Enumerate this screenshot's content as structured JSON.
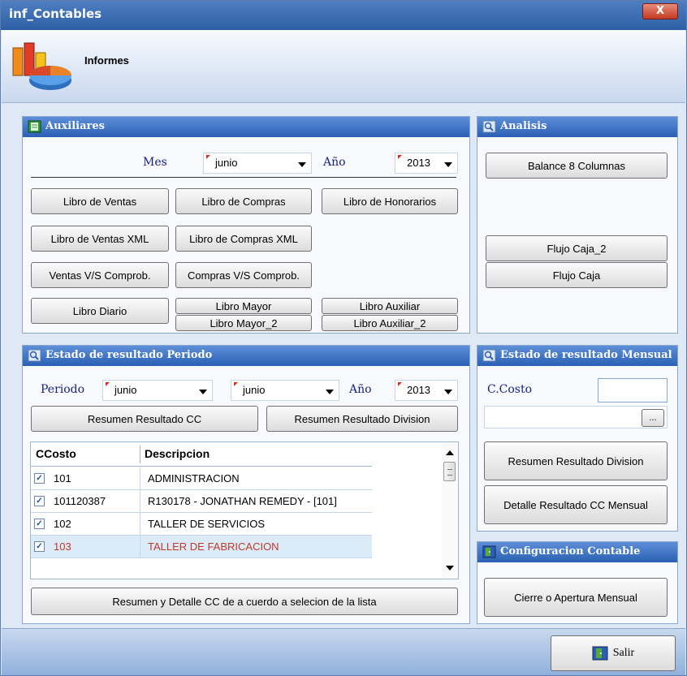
{
  "window": {
    "title": "inf_Contables",
    "close_label": "X"
  },
  "header": {
    "title": "Informes"
  },
  "auxiliares": {
    "title": "Auxiliares",
    "mes_label": "Mes",
    "mes_value": "junio",
    "anio_label": "Año",
    "anio_value": "2013",
    "buttons": {
      "libro_ventas": "Libro de Ventas",
      "libro_compras": "Libro de Compras",
      "libro_honorarios": "Libro de Honorarios",
      "libro_ventas_xml": "Libro de Ventas XML",
      "libro_compras_xml": "Libro de Compras XML",
      "ventas_vs": "Ventas V/S Comprob.",
      "compras_vs": "Compras V/S Comprob.",
      "libro_diario": "Libro Diario",
      "libro_mayor": "Libro Mayor",
      "libro_mayor_2": "Libro Mayor_2",
      "libro_auxiliar": "Libro Auxiliar",
      "libro_auxiliar_2": "Libro Auxiliar_2"
    }
  },
  "analisis": {
    "title": "Analisis",
    "balance": "Balance 8 Columnas",
    "flujo_caja_2": "Flujo Caja_2",
    "flujo_caja": "Flujo Caja"
  },
  "periodo": {
    "title": "Estado de resultado Periodo",
    "periodo_label": "Periodo",
    "desde": "junio",
    "hasta": "junio",
    "anio_label": "Año",
    "anio_value": "2013",
    "resumen_cc": "Resumen Resultado CC",
    "resumen_div": "Resumen Resultado Division",
    "grid": {
      "headers": [
        "CCosto",
        "Descripcion"
      ],
      "rows": [
        {
          "check": "✓",
          "code": "101",
          "desc": "ADMINISTRACION"
        },
        {
          "check": "✓",
          "code": "101120387",
          "desc": "R130178 - JONATHAN REMEDY - [101]"
        },
        {
          "check": "✓",
          "code": "102",
          "desc": "TALLER DE SERVICIOS"
        },
        {
          "check": "✓",
          "code": "103",
          "desc": "TALLER DE FABRICACION"
        }
      ]
    },
    "resumen_detalle": "Resumen y Detalle CC de a cuerdo a selecion de la lista"
  },
  "mensual": {
    "title": "Estado de resultado Mensual",
    "ccosto_label": "C.Costo",
    "browse": "...",
    "resumen_div": "Resumen Resultado Division",
    "detalle_cc": "Detalle Resultado CC Mensual"
  },
  "config": {
    "title": "Configuracion Contable",
    "cierre": "Cierre o Apertura Mensual"
  },
  "footer": {
    "salir": "Salir"
  }
}
